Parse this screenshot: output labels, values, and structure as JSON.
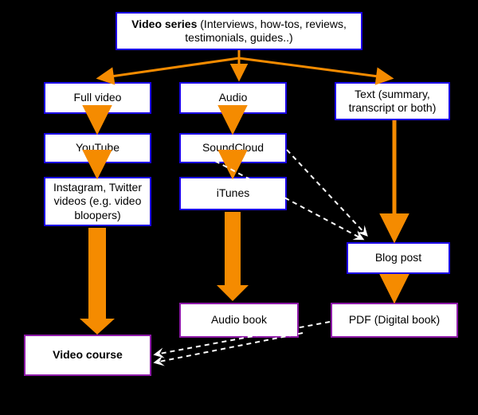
{
  "colors": {
    "blue": "#1b00e6",
    "purple": "#8e1aa8",
    "arrow": "#f58b00",
    "dashed": "#ffffff"
  },
  "nodes": {
    "root_a": "Video series",
    "root_b": " (Interviews, how-tos, reviews, testimonials, guides..)",
    "fullvideo": "Full video",
    "youtube": "YouTube",
    "social": "Instagram, Twitter videos (e.g. video bloopers)",
    "audio": "Audio",
    "soundcloud": "SoundCloud",
    "itunes": "iTunes",
    "text": "Text (summary, transcript or both)",
    "blogpost": "Blog post",
    "videocourse": "Video course",
    "audiobook": "Audio book",
    "pdfbook": "PDF (Digital book)"
  }
}
